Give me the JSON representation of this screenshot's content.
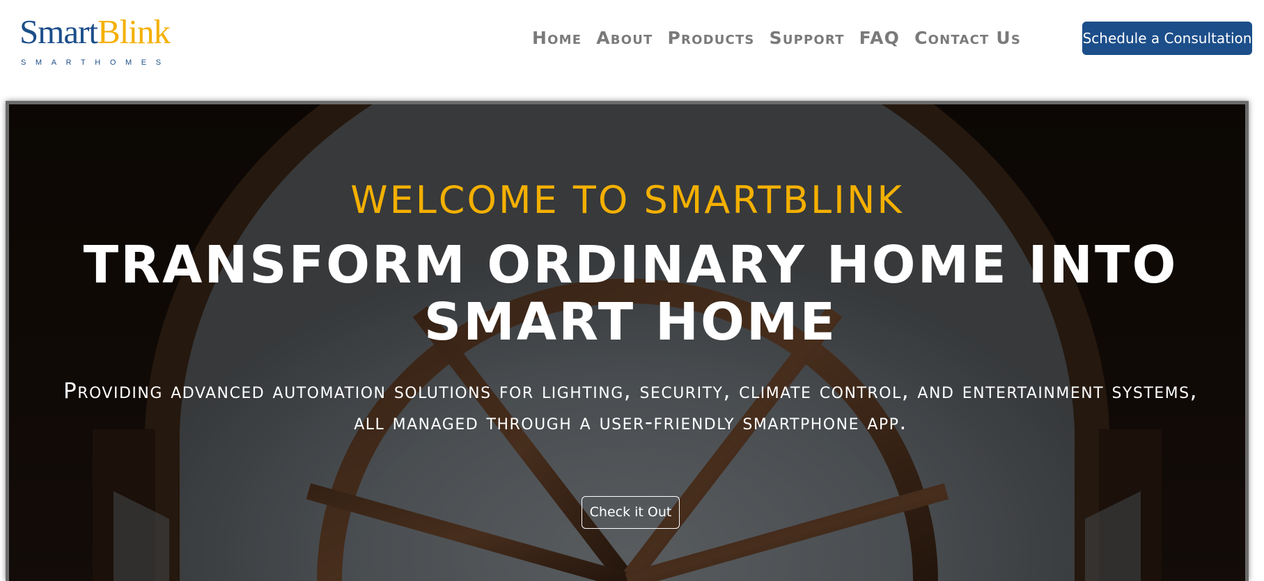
{
  "brand": {
    "name_part1": "Smart",
    "name_part2": "Blink",
    "tagline": "SMARTHOMES",
    "colors": {
      "primary": "#1c4e8a",
      "accent": "#f4b000"
    }
  },
  "nav": {
    "items": [
      {
        "label": "Home"
      },
      {
        "label": "About"
      },
      {
        "label": "Products"
      },
      {
        "label": "Support"
      },
      {
        "label": "FAQ"
      },
      {
        "label": "Contact Us"
      }
    ],
    "cta_label": "Schedule a Consultation"
  },
  "hero": {
    "eyebrow": "WELCOME TO SMARTBLINK",
    "title": "TRANSFORM ORDINARY HOME INTO SMART HOME",
    "subtitle": "Providing advanced automation solutions for lighting, security, climate control, and entertainment systems, all managed through a user-friendly smartphone app.",
    "button_label": "Check it Out"
  }
}
